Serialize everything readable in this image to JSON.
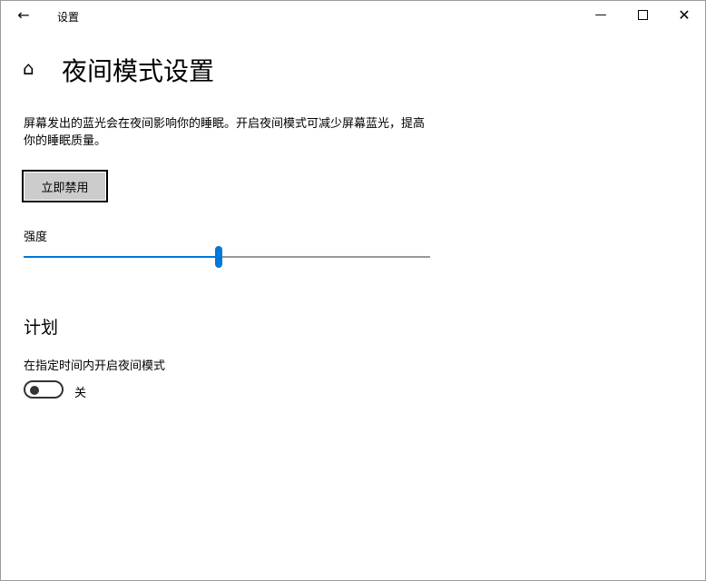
{
  "titlebar": {
    "app_title": "设置",
    "back_icon": "arrow-left-icon",
    "minimize_icon": "minimize-icon",
    "maximize_icon": "maximize-icon",
    "close_icon": "close-icon"
  },
  "page": {
    "home_icon": "home-icon",
    "title": "夜间模式设置",
    "description": "屏幕发出的蓝光会在夜间影响你的睡眠。开启夜间模式可减少屏幕蓝光，提高你的睡眠质量。",
    "disable_button": "立即禁用"
  },
  "strength": {
    "label": "强度",
    "value_percent": 48,
    "accent": "#0078d7"
  },
  "schedule": {
    "heading": "计划",
    "toggle_label": "在指定时间内开启夜间模式",
    "toggle_state": "关",
    "toggle_on": false
  }
}
